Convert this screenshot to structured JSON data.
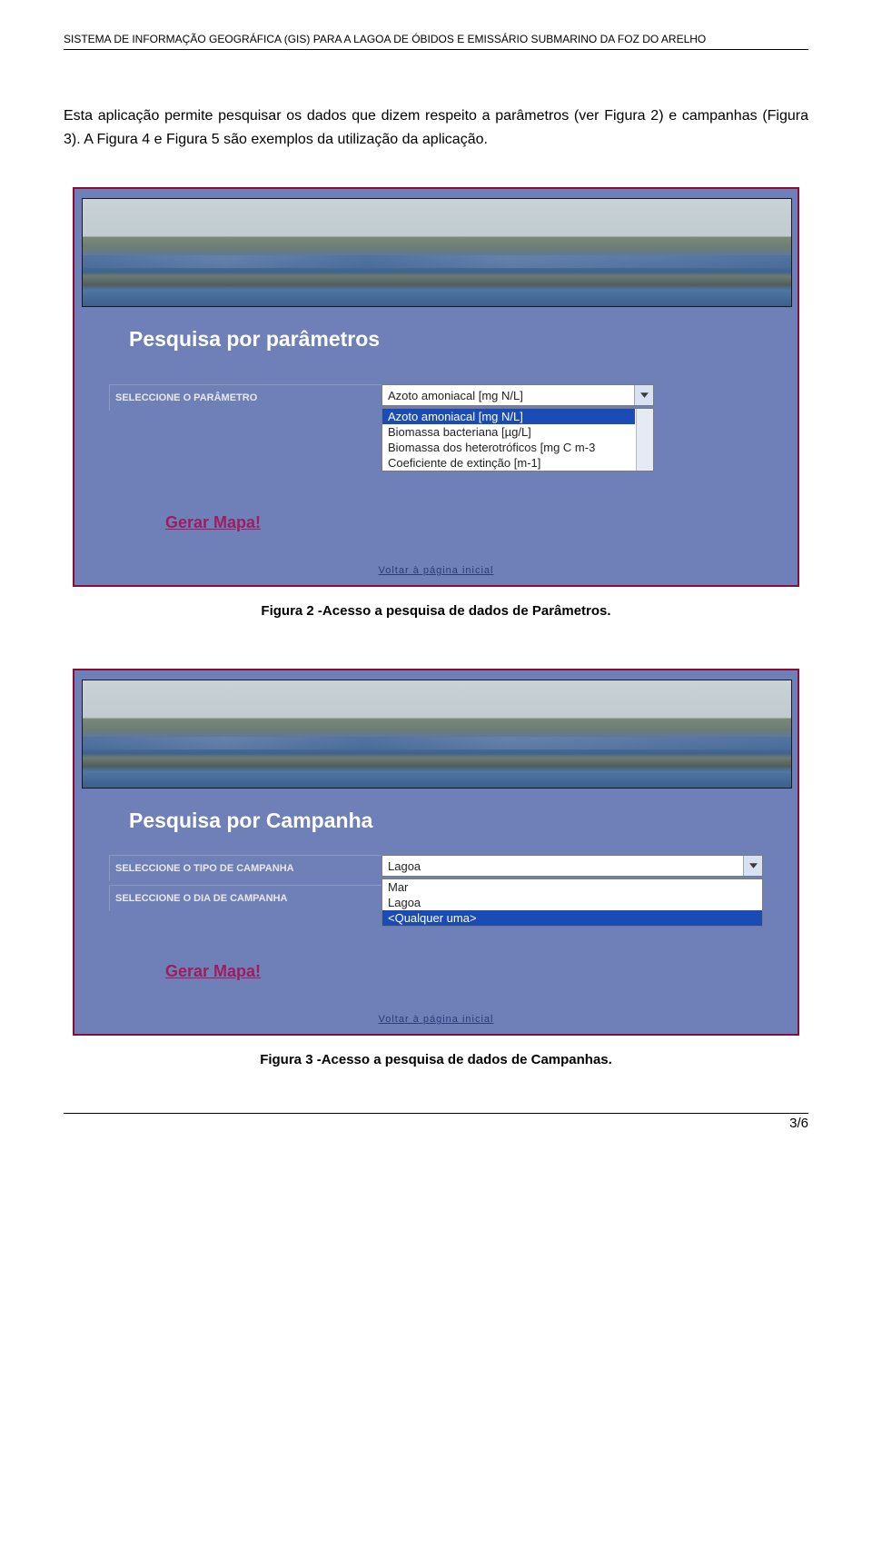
{
  "header": "SISTEMA DE INFORMAÇÃO GEOGRÁFICA (GIS) PARA A LAGOA DE ÓBIDOS E EMISSÁRIO SUBMARINO DA FOZ DO ARELHO",
  "intro": "Esta aplicação permite pesquisar os dados que dizem respeito a parâmetros (ver Figura 2) e campanhas (Figura 3). A Figura 4 e Figura 5 são exemplos da utilização da aplicação.",
  "fig1": {
    "title": "Pesquisa por parâmetros",
    "label": "SELECCIONE O PARÂMETRO",
    "selected": "Azoto amoniacal [mg N/L]",
    "options": [
      "Azoto amoniacal [mg N/L]",
      "Biomassa bacteriana [µg/L]",
      "Biomassa dos heterotróficos [mg C m-3",
      "Coeficiente de extinção [m-1]"
    ],
    "gen": "Gerar Mapa!",
    "back": "Voltar à página inicial"
  },
  "caption1": "Figura 2 -Acesso a pesquisa de dados de Parâmetros.",
  "fig2": {
    "title": "Pesquisa por Campanha",
    "label1": "SELECCIONE O TIPO DE CAMPANHA",
    "label2": "SELECCIONE O DIA DE CAMPANHA",
    "selected": "Lagoa",
    "options": [
      "Mar",
      "Lagoa",
      "<Qualquer uma>"
    ],
    "gen": "Gerar Mapa!",
    "back": "Voltar à página inicial"
  },
  "caption2": "Figura 3 -Acesso a pesquisa de dados de Campanhas.",
  "pagenum": "3/6"
}
